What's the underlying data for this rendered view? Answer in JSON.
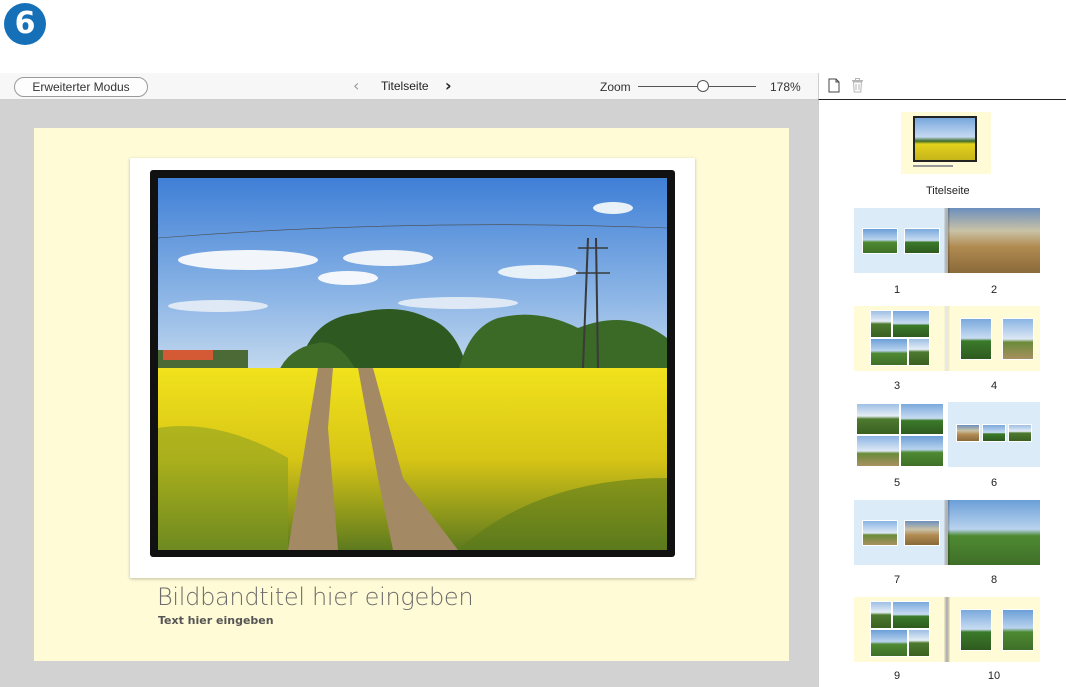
{
  "step_badge": "6",
  "toolbar": {
    "mode_button": "Erweiterter Modus",
    "prev_icon": "‹",
    "page_title": "Titelseite",
    "next_icon": "›",
    "zoom_label": "Zoom",
    "zoom_value": "178%",
    "zoom_level_fraction": 0.55
  },
  "side_toolbar": {
    "new_page_icon": "page-icon",
    "delete_icon": "trash-icon"
  },
  "page": {
    "title_placeholder": "Bildbandtitel hier eingeben",
    "subtitle_placeholder": "Text hier eingeben"
  },
  "sidebar": {
    "cover_label": "Titelseite",
    "spreads": [
      {
        "left": "1",
        "right": "2"
      },
      {
        "left": "3",
        "right": "4"
      },
      {
        "left": "5",
        "right": "6"
      },
      {
        "left": "7",
        "right": "8"
      },
      {
        "left": "9",
        "right": "10"
      }
    ]
  },
  "colors": {
    "accent": "#1570b8",
    "page_background": "#fffbd6",
    "canvas_background": "#d2d2d2",
    "spread_blue": "#dcebf8"
  }
}
